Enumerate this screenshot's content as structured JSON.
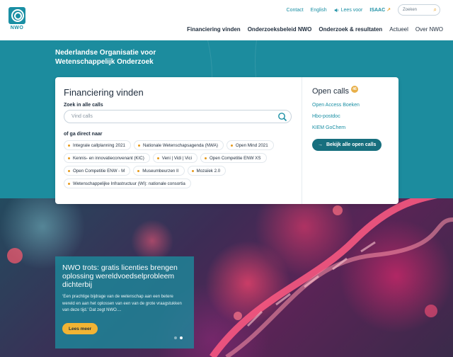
{
  "header": {
    "logo_text": "NWO",
    "utility": {
      "contact": "Contact",
      "language": "English",
      "listen": "Lees voor",
      "isaac": "ISAAC",
      "search_placeholder": "Zoeken"
    },
    "nav": [
      {
        "label": "Financiering vinden"
      },
      {
        "label": "Onderzoeksbeleid NWO"
      },
      {
        "label": "Onderzoek & resultaten"
      },
      {
        "label": "Actueel"
      },
      {
        "label": "Over NWO"
      }
    ]
  },
  "hero": {
    "title": "Nederlandse Organisatie voor Wetenschappelijk Onderzoek"
  },
  "financing": {
    "heading": "Financiering vinden",
    "search_label": "Zoek in alle calls",
    "search_placeholder": "Vind calls",
    "direct_label": "of ga direct naar",
    "tags": [
      "Integrale callplanning 2021",
      "Nationale Wetenschapsagenda (NWA)",
      "Open Mind 2021",
      "Kennis- en innovatieconvenant (KIC)",
      "Veni | Vidi | Vici",
      "Open Competitie ENW XS",
      "Open Competitie ENW - M",
      "Museumbeurzen II",
      "Mozaïek 2.0",
      "Wetenschappelijke Infrastructuur (WI): nationale consortia"
    ]
  },
  "open_calls": {
    "heading": "Open calls",
    "count": "46",
    "links": [
      "Open Access Boeken",
      "Hbo-postdoc",
      "KIEM GoChem"
    ],
    "button": "Bekijk alle open calls"
  },
  "news": {
    "title": "NWO trots: gratis licenties brengen oplossing wereldvoedselprobleem dichterbij",
    "text": "‘Een prachtige bijdrage van de wetenschap aan een betere wereld en aan het oplossen van een van de grote vraagstukken van deze tijd.’ Dat zegt NWO....",
    "button": "Lees meer"
  },
  "colors": {
    "teal": "#1c8c9e",
    "dark_teal": "#176f7e",
    "accent_orange": "#e69a1c",
    "button_yellow": "#f1b434"
  }
}
